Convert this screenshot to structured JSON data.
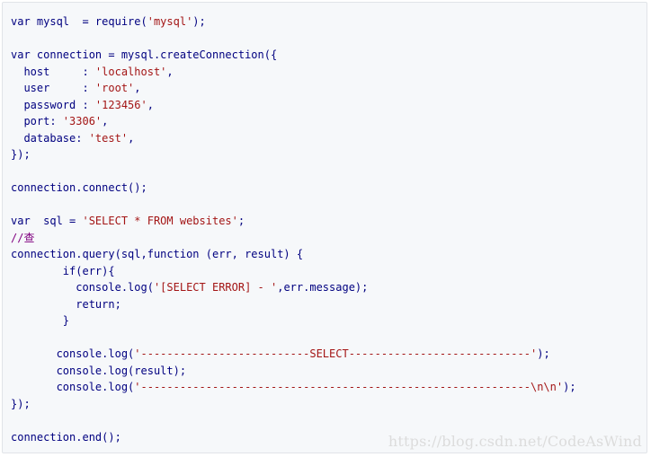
{
  "code_lines": [
    {
      "parts": [
        {
          "t": "var mysql  = require("
        },
        {
          "t": "'mysql'",
          "c": "str"
        },
        {
          "t": ");"
        }
      ]
    },
    {
      "parts": [
        {
          "t": ""
        }
      ]
    },
    {
      "parts": [
        {
          "t": "var connection = mysql.createConnection({"
        }
      ]
    },
    {
      "parts": [
        {
          "t": "  host     : "
        },
        {
          "t": "'localhost'",
          "c": "str"
        },
        {
          "t": ","
        }
      ]
    },
    {
      "parts": [
        {
          "t": "  user     : "
        },
        {
          "t": "'root'",
          "c": "str"
        },
        {
          "t": ","
        }
      ]
    },
    {
      "parts": [
        {
          "t": "  password : "
        },
        {
          "t": "'123456'",
          "c": "str"
        },
        {
          "t": ","
        }
      ]
    },
    {
      "parts": [
        {
          "t": "  port: "
        },
        {
          "t": "'3306'",
          "c": "str"
        },
        {
          "t": ","
        }
      ]
    },
    {
      "parts": [
        {
          "t": "  database: "
        },
        {
          "t": "'test'",
          "c": "str"
        },
        {
          "t": ","
        }
      ]
    },
    {
      "parts": [
        {
          "t": "});"
        }
      ]
    },
    {
      "parts": [
        {
          "t": ""
        }
      ]
    },
    {
      "parts": [
        {
          "t": "connection.connect();"
        }
      ]
    },
    {
      "parts": [
        {
          "t": ""
        }
      ]
    },
    {
      "parts": [
        {
          "t": "var  sql = "
        },
        {
          "t": "'SELECT * FROM websites'",
          "c": "str"
        },
        {
          "t": ";"
        }
      ]
    },
    {
      "parts": [
        {
          "t": "//查",
          "c": "cm"
        }
      ]
    },
    {
      "parts": [
        {
          "t": "connection.query(sql,function (err, result) {"
        }
      ]
    },
    {
      "parts": [
        {
          "t": "        if(err){"
        }
      ]
    },
    {
      "parts": [
        {
          "t": "          console.log("
        },
        {
          "t": "'[SELECT ERROR] - '",
          "c": "str"
        },
        {
          "t": ",err.message);"
        }
      ]
    },
    {
      "parts": [
        {
          "t": "          return;"
        }
      ]
    },
    {
      "parts": [
        {
          "t": "        }"
        }
      ]
    },
    {
      "parts": [
        {
          "t": ""
        }
      ]
    },
    {
      "parts": [
        {
          "t": "       console.log("
        },
        {
          "t": "'--------------------------SELECT----------------------------'",
          "c": "str"
        },
        {
          "t": ");"
        }
      ]
    },
    {
      "parts": [
        {
          "t": "       console.log(result);"
        }
      ]
    },
    {
      "parts": [
        {
          "t": "       console.log("
        },
        {
          "t": "'------------------------------------------------------------\\n\\n'",
          "c": "str"
        },
        {
          "t": ");"
        }
      ]
    },
    {
      "parts": [
        {
          "t": "});"
        }
      ]
    },
    {
      "parts": [
        {
          "t": ""
        }
      ]
    },
    {
      "parts": [
        {
          "t": "connection.end();"
        }
      ]
    }
  ],
  "watermark": "https://blog.csdn.net/CodeAsWind",
  "colors": {
    "code_text": "#000080",
    "string": "#a31515",
    "comment": "#800080",
    "background": "#f6f8fa"
  }
}
